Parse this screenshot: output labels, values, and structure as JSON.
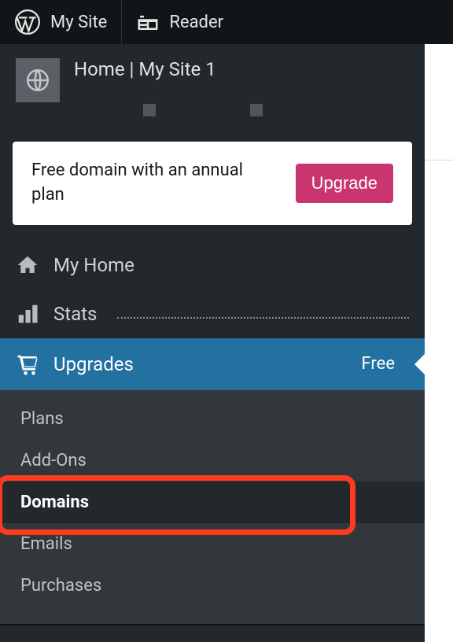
{
  "topbar": {
    "mysite_label": "My Site",
    "reader_label": "Reader"
  },
  "site": {
    "title": "Home | My Site 1"
  },
  "promo": {
    "text": "Free domain with an annual plan",
    "button": "Upgrade"
  },
  "nav": {
    "home": "My Home",
    "stats": "Stats",
    "upgrades": "Upgrades",
    "upgrades_badge": "Free"
  },
  "submenu": {
    "plans": "Plans",
    "addons": "Add-Ons",
    "domains": "Domains",
    "emails": "Emails",
    "purchases": "Purchases"
  }
}
